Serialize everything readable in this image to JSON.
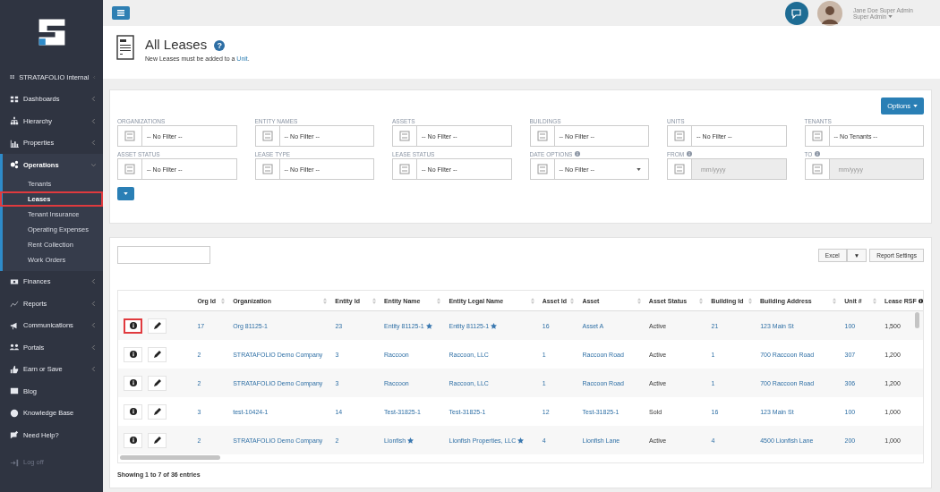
{
  "sidebar": {
    "items": [
      {
        "label": "STRATAFOLIO Internal",
        "kind": "section",
        "expanded": false
      },
      {
        "label": "Dashboards",
        "kind": "section",
        "expanded": false
      },
      {
        "label": "Hierarchy",
        "kind": "section",
        "expanded": false
      },
      {
        "label": "Properties",
        "kind": "section",
        "expanded": false
      },
      {
        "label": "Operations",
        "kind": "section",
        "expanded": true,
        "children": [
          {
            "label": "Tenants",
            "selected": false
          },
          {
            "label": "Leases",
            "selected": true
          },
          {
            "label": "Tenant Insurance",
            "selected": false
          },
          {
            "label": "Operating Expenses",
            "selected": false
          },
          {
            "label": "Rent Collection",
            "selected": false
          },
          {
            "label": "Work Orders",
            "selected": false
          }
        ]
      },
      {
        "label": "Finances",
        "kind": "section",
        "expanded": false
      },
      {
        "label": "Reports",
        "kind": "section",
        "expanded": false
      },
      {
        "label": "Communications",
        "kind": "section",
        "expanded": false
      },
      {
        "label": "Portals",
        "kind": "section",
        "expanded": false
      },
      {
        "label": "Earn or Save",
        "kind": "section",
        "expanded": false
      },
      {
        "label": "Blog",
        "kind": "link"
      },
      {
        "label": "Knowledge Base",
        "kind": "link"
      },
      {
        "label": "Need Help?",
        "kind": "link"
      },
      {
        "label": "Log off",
        "kind": "logoff"
      }
    ]
  },
  "user": {
    "name": "Jane Doe Super Admin",
    "role": "Super Admin"
  },
  "header": {
    "title": "All Leases",
    "help": "?",
    "note": "New Leases must be added to a ",
    "note_link": "Unit",
    "note_end": "."
  },
  "filters": {
    "options_button": "Options",
    "fields": [
      {
        "label": "ORGANIZATIONS",
        "value": "-- No Filter --",
        "kind": "select",
        "info": false
      },
      {
        "label": "ENTITY NAMES",
        "value": "-- No Filter --",
        "kind": "select",
        "info": false
      },
      {
        "label": "ASSETS",
        "value": "-- No Filter --",
        "kind": "select",
        "info": false
      },
      {
        "label": "BUILDINGS",
        "value": "-- No Filter --",
        "kind": "select",
        "info": false
      },
      {
        "label": "UNITS",
        "value": "-- No Filter --",
        "kind": "select",
        "info": false
      },
      {
        "label": "TENANTS",
        "value": "-- No Tenants --",
        "kind": "select",
        "info": false
      },
      {
        "label": "ASSET STATUS",
        "value": "-- No Filter --",
        "kind": "select",
        "info": false
      },
      {
        "label": "LEASE TYPE",
        "value": "-- No Filter --",
        "kind": "select",
        "info": false
      },
      {
        "label": "LEASE STATUS",
        "value": "-- No Filter --",
        "kind": "select",
        "info": false
      },
      {
        "label": "DATE OPTIONS",
        "value": "-- No Filter --",
        "kind": "dropdown",
        "info": true
      },
      {
        "label": "FROM",
        "placeholder": "mm/yyyy",
        "kind": "date",
        "info": true
      },
      {
        "label": "TO",
        "placeholder": "mm/yyyy",
        "kind": "date",
        "info": true
      }
    ]
  },
  "table": {
    "excel_button": "Excel",
    "dropdown_button": "▼",
    "settings_button": "Report Settings",
    "columns": [
      {
        "label": "Org Id",
        "kind": "link",
        "info": false
      },
      {
        "label": "Organization",
        "kind": "link",
        "info": false
      },
      {
        "label": "Entity Id",
        "kind": "link",
        "info": false
      },
      {
        "label": "Entity Name",
        "kind": "link",
        "info": false
      },
      {
        "label": "Entity Legal Name",
        "kind": "link",
        "info": false
      },
      {
        "label": "Asset Id",
        "kind": "link",
        "info": false
      },
      {
        "label": "Asset",
        "kind": "link",
        "info": false
      },
      {
        "label": "Asset Status",
        "kind": "text",
        "info": false
      },
      {
        "label": "Building Id",
        "kind": "link",
        "info": false
      },
      {
        "label": "Building Address",
        "kind": "link",
        "info": false
      },
      {
        "label": "Unit #",
        "kind": "link",
        "info": false
      },
      {
        "label": "Lease RSF",
        "kind": "text",
        "info": true
      }
    ],
    "rows": [
      {
        "highlighted": true,
        "entity_starred": true,
        "legal_starred": true,
        "cells": [
          "17",
          "Org 81125-1",
          "23",
          "Entity 81125-1",
          "Entity 81125-1",
          "16",
          "Asset A",
          "Active",
          "21",
          "123 Main St",
          "100",
          "1,500"
        ]
      },
      {
        "highlighted": false,
        "entity_starred": false,
        "legal_starred": false,
        "cells": [
          "2",
          "STRATAFOLIO Demo Company",
          "3",
          "Raccoon",
          "Raccoon, LLC",
          "1",
          "Raccoon Road",
          "Active",
          "1",
          "700 Raccoon Road",
          "307",
          "1,200"
        ]
      },
      {
        "highlighted": false,
        "entity_starred": false,
        "legal_starred": false,
        "cells": [
          "2",
          "STRATAFOLIO Demo Company",
          "3",
          "Raccoon",
          "Raccoon, LLC",
          "1",
          "Raccoon Road",
          "Active",
          "1",
          "700 Raccoon Road",
          "306",
          "1,200"
        ]
      },
      {
        "highlighted": false,
        "entity_starred": false,
        "legal_starred": false,
        "cells": [
          "3",
          "test-10424-1",
          "14",
          "Test-31825-1",
          "Test-31825-1",
          "12",
          "Test-31825-1",
          "Sold",
          "16",
          "123 Main St",
          "100",
          "1,000"
        ]
      },
      {
        "highlighted": false,
        "entity_starred": true,
        "legal_starred": true,
        "cells": [
          "2",
          "STRATAFOLIO Demo Company",
          "2",
          "Lionfish",
          "Lionfish Properties, LLC",
          "4",
          "Lionfish Lane",
          "Active",
          "4",
          "4500 Lionfish Lane",
          "200",
          "1,000"
        ]
      }
    ],
    "footer": "Showing 1 to 7 of 36 entries"
  }
}
